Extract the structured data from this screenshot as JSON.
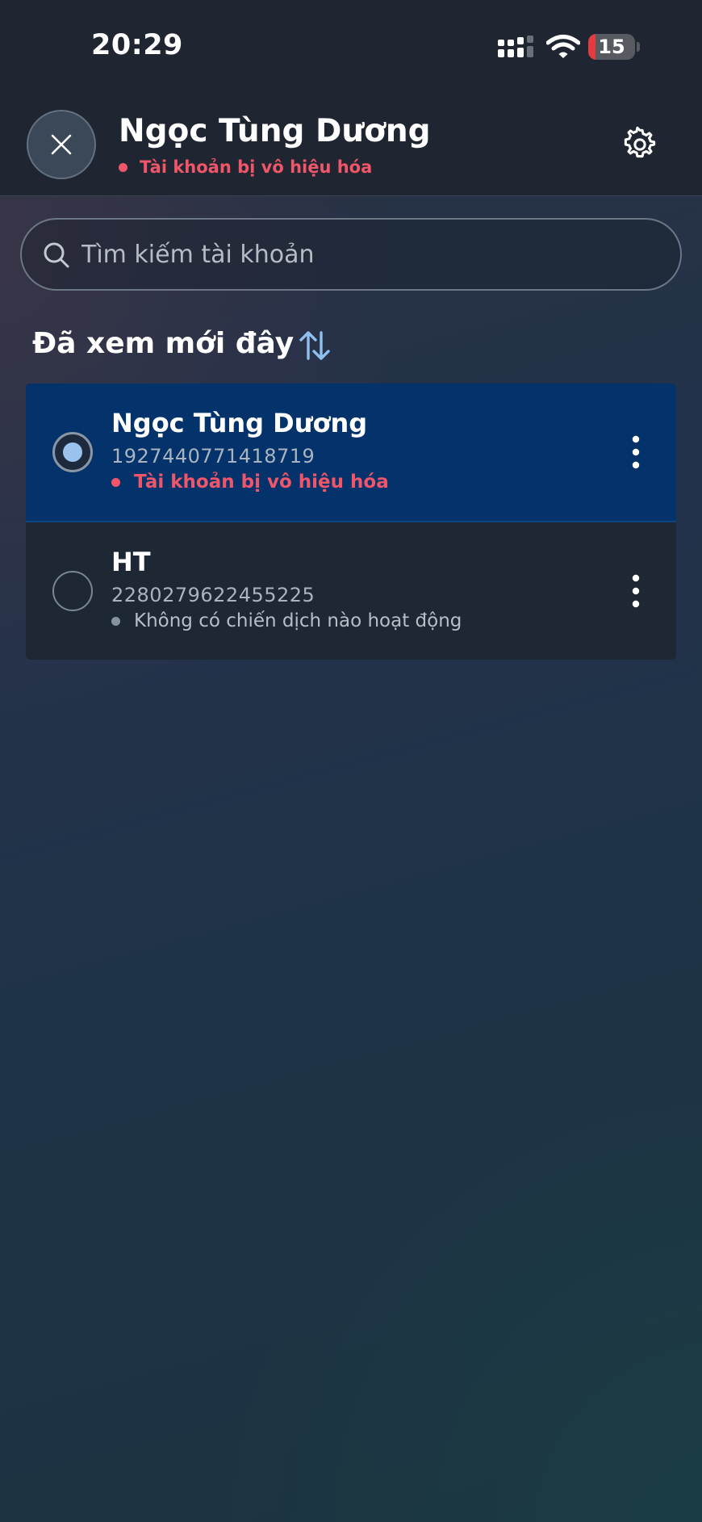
{
  "status_bar": {
    "time": "20:29",
    "battery_level": "15",
    "battery_fraction": 0.15,
    "icons": [
      "signal-icon",
      "wifi-icon",
      "battery-icon"
    ]
  },
  "header": {
    "title": "Ngọc Tùng Dương",
    "status": "Tài khoản bị vô hiệu hóa",
    "status_color": "#f0566a",
    "icons": [
      "close-icon",
      "gear-icon"
    ]
  },
  "search": {
    "placeholder": "Tìm kiếm tài khoản",
    "value": ""
  },
  "section": {
    "title": "Đã xem mới đây",
    "sort_icon": "sort-arrows-icon"
  },
  "accounts": [
    {
      "name": "Ngọc Tùng Dương",
      "id": "1927440771418719",
      "status": "Tài khoản bị vô hiệu hóa",
      "status_type": "disabled",
      "selected": true
    },
    {
      "name": "HT",
      "id": "2280279622455225",
      "status": "Không có chiến dịch nào hoạt động",
      "status_type": "inactive",
      "selected": false
    }
  ],
  "colors": {
    "accent_blue": "#9ac3ec",
    "selected_row": "#04326a",
    "error_red": "#f0566a"
  }
}
